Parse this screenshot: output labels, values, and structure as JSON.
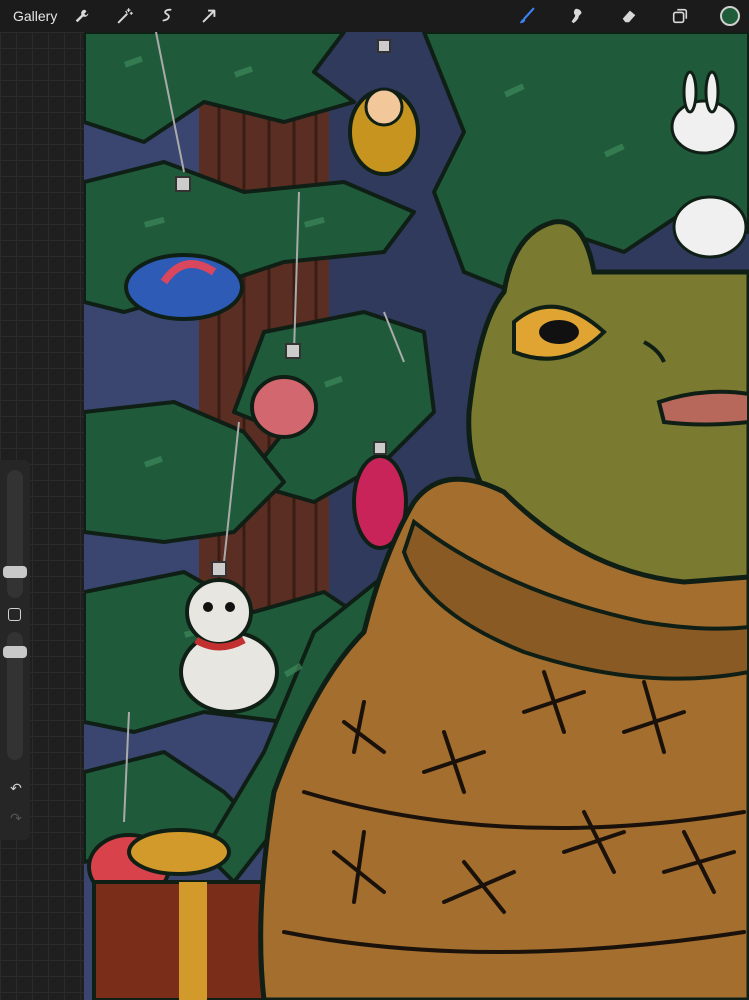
{
  "toolbar": {
    "gallery_label": "Gallery",
    "left_tools": [
      "wrench-icon",
      "magic-wand-icon",
      "selection-icon",
      "transform-icon"
    ],
    "right_tools": [
      "brush-icon",
      "smudge-icon",
      "eraser-icon",
      "layers-icon"
    ],
    "active_tool": "brush-icon",
    "active_color": "#1f5d3a",
    "accent_color": "#3b82f6"
  },
  "sidebar": {
    "controls": [
      "brush-size-slider",
      "modify-button",
      "opacity-slider",
      "undo-icon",
      "redo-icon"
    ]
  }
}
